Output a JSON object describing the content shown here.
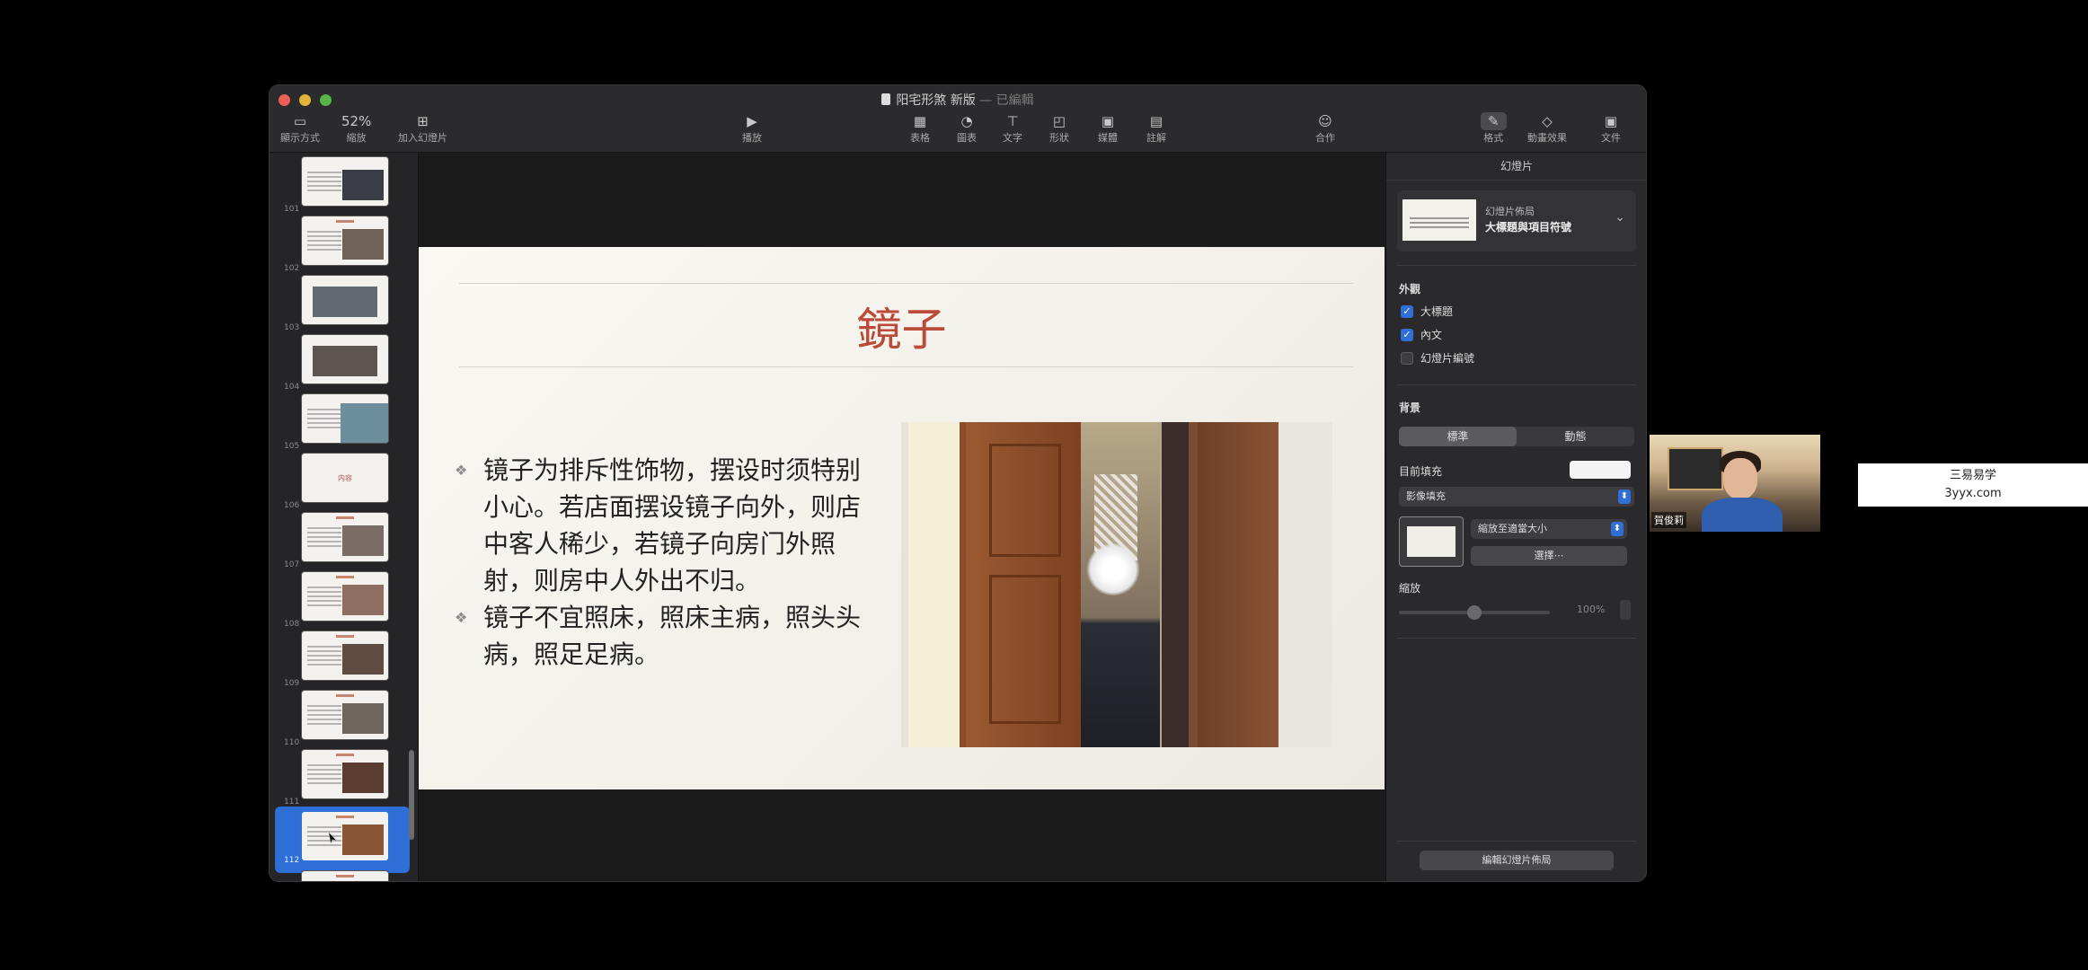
{
  "window": {
    "doc_title": "阳宅形煞 新版",
    "doc_status": "— 已編輯"
  },
  "toolbar": {
    "view": "顯示方式",
    "zoom_value": "52%",
    "zoom": "縮放",
    "add_slide": "加入幻燈片",
    "play": "播放",
    "table": "表格",
    "chart": "圖表",
    "text": "文字",
    "shape": "形狀",
    "media": "媒體",
    "comment": "註解",
    "collaborate": "合作",
    "format": "格式",
    "animate": "動畫效果",
    "document": "文件"
  },
  "navigator": {
    "slides": [
      {
        "num": "101"
      },
      {
        "num": "102"
      },
      {
        "num": "103"
      },
      {
        "num": "104"
      },
      {
        "num": "105"
      },
      {
        "num": "106",
        "label": "内容"
      },
      {
        "num": "107"
      },
      {
        "num": "108"
      },
      {
        "num": "109"
      },
      {
        "num": "110"
      },
      {
        "num": "111"
      },
      {
        "num": "112",
        "selected": true
      },
      {
        "num": "113"
      }
    ]
  },
  "slide": {
    "title": "鏡子",
    "bullets": [
      "镜子为排斥性饰物，摆设时须特别小心。若店面摆设镜子向外，则店中客人稀少，若镜子向房门外照射，则房中人外出不归。",
      "镜子不宜照床，照床主病，照头头病，照足足病。"
    ]
  },
  "inspector": {
    "header": "幻燈片",
    "layout_label": "幻燈片佈局",
    "layout_value": "大標題與項目符號",
    "appearance": "外觀",
    "check_title": "大標題",
    "check_body": "內文",
    "check_slide_number": "幻燈片編號",
    "background": "背景",
    "seg_standard": "標準",
    "seg_dynamic": "動態",
    "current_fill": "目前填充",
    "fill_type": "影像填充",
    "scale_mode": "縮放至適當大小",
    "choose": "選擇⋯",
    "scale": "縮放",
    "scale_value": "100%",
    "edit_layout": "編輯幻燈片佈局"
  },
  "webcam": {
    "name": "賀俊莉"
  },
  "watermark": {
    "line1": "三易易学",
    "line2": "3yyx.com"
  }
}
